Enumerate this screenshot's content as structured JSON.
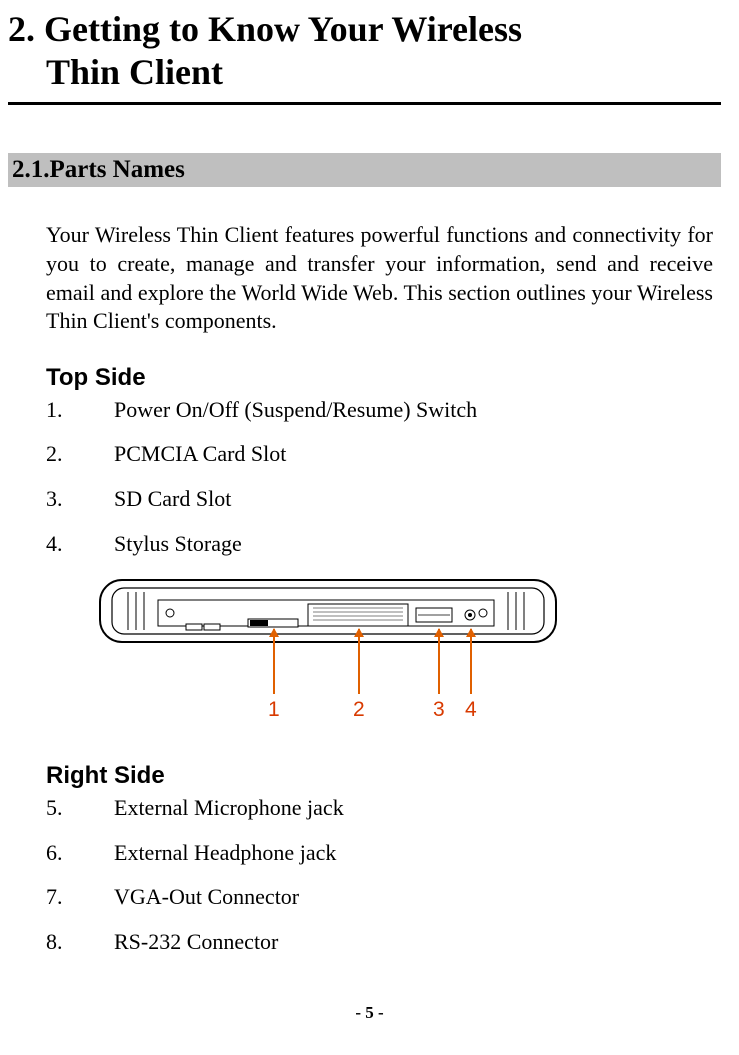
{
  "chapter": {
    "line1": "2. Getting to Know Your Wireless",
    "line2": "Thin Client"
  },
  "section": {
    "number_title": "2.1.Parts Names"
  },
  "intro": "Your Wireless Thin Client features powerful functions and connectivity for you to create, manage and transfer your information, send and receive email and explore the World Wide Web. This section outlines your Wireless Thin Client's components.",
  "top_side": {
    "heading": "Top Side",
    "items": [
      {
        "num": "1.",
        "text": "Power On/Off (Suspend/Resume) Switch"
      },
      {
        "num": "2.",
        "text": "PCMCIA Card Slot"
      },
      {
        "num": "3.",
        "text": "SD Card Slot"
      },
      {
        "num": "4.",
        "text": "Stylus Storage"
      }
    ]
  },
  "callouts": [
    "1",
    "2",
    "3",
    "4"
  ],
  "right_side": {
    "heading": "Right Side",
    "items": [
      {
        "num": "5.",
        "text": "External Microphone jack"
      },
      {
        "num": "6.",
        "text": "External Headphone jack"
      },
      {
        "num": "7.",
        "text": "VGA-Out Connector"
      },
      {
        "num": "8.",
        "text": "RS-232 Connector"
      }
    ]
  },
  "page_number": "- 5 -"
}
